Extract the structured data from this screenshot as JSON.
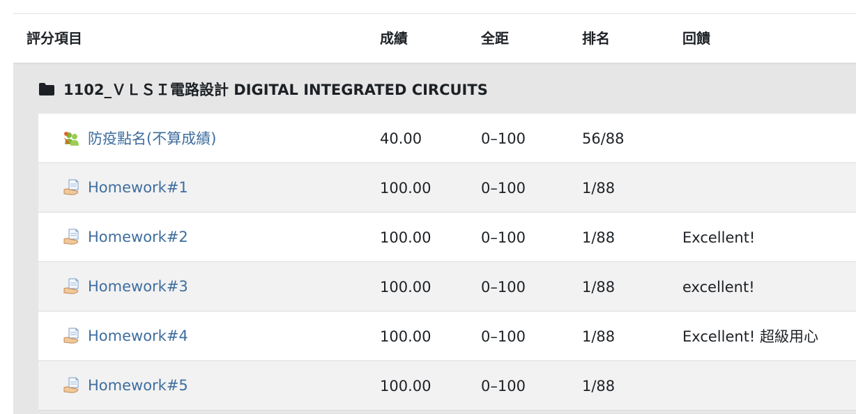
{
  "table": {
    "headers": {
      "item": "評分項目",
      "grade": "成績",
      "range": "全距",
      "rank": "排名",
      "feedback": "回饋"
    },
    "category": {
      "title": "1102_ＶＬＳＩ電路設計 DIGITAL INTEGRATED CIRCUITS",
      "icon": "folder-icon"
    },
    "rows": [
      {
        "name": "防疫點名(不算成績)",
        "icon": "attendance-icon",
        "grade": "40.00",
        "range": "0–100",
        "rank": "56/88",
        "feedback": ""
      },
      {
        "name": "Homework#1",
        "icon": "assignment-icon",
        "grade": "100.00",
        "range": "0–100",
        "rank": "1/88",
        "feedback": ""
      },
      {
        "name": "Homework#2",
        "icon": "assignment-icon",
        "grade": "100.00",
        "range": "0–100",
        "rank": "1/88",
        "feedback": "Excellent!"
      },
      {
        "name": "Homework#3",
        "icon": "assignment-icon",
        "grade": "100.00",
        "range": "0–100",
        "rank": "1/88",
        "feedback": "excellent!"
      },
      {
        "name": "Homework#4",
        "icon": "assignment-icon",
        "grade": "100.00",
        "range": "0–100",
        "rank": "1/88",
        "feedback": "Excellent! 超級用心"
      },
      {
        "name": "Homework#5",
        "icon": "assignment-icon",
        "grade": "100.00",
        "range": "0–100",
        "rank": "1/88",
        "feedback": ""
      }
    ]
  },
  "colors": {
    "link": "#3e6d9e",
    "category_band": "#e6e6e6",
    "row_alt": "#f2f2f2"
  }
}
